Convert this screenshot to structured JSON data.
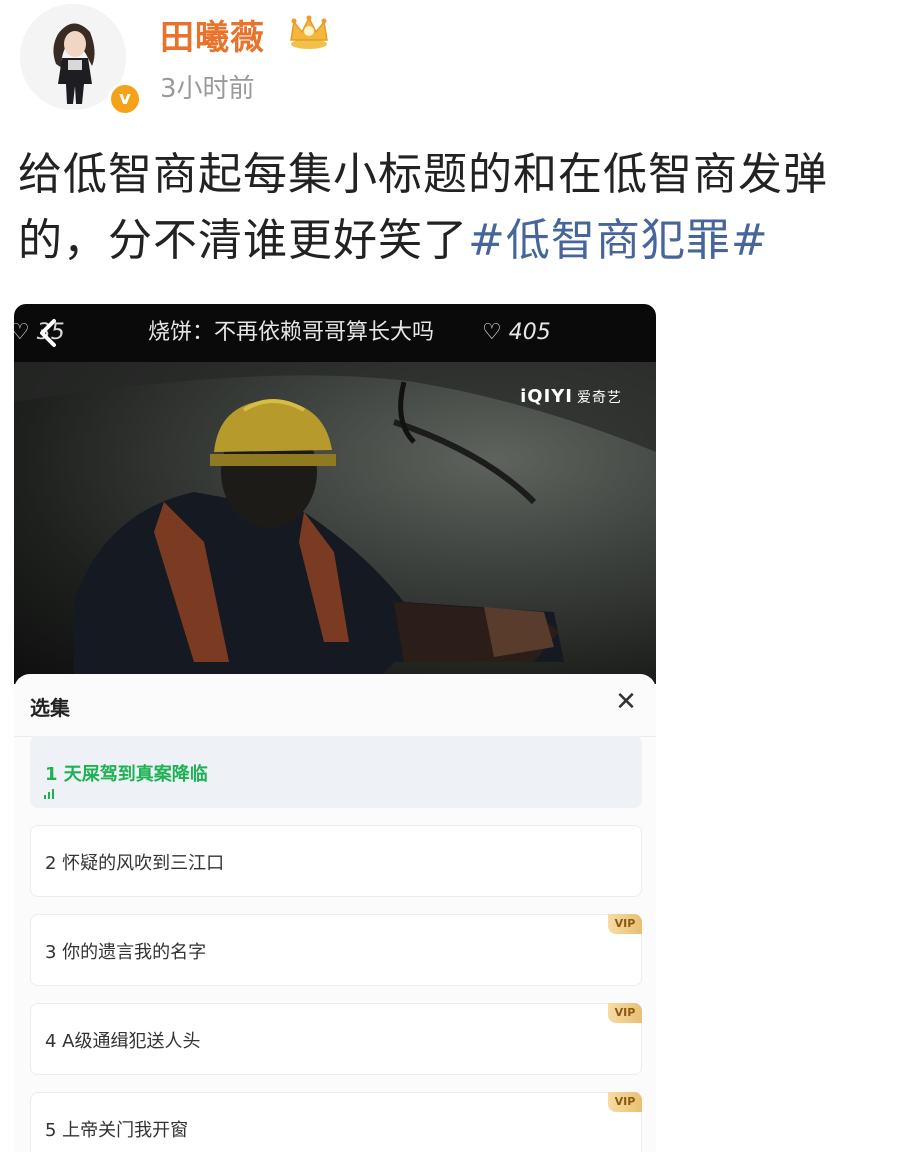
{
  "post": {
    "author": "田曦薇",
    "time": "3小时前",
    "text": "给低智商起每集小标题的和在低智商发弹的，分不清谁更好笑了",
    "hashtag": "#低智商犯罪#"
  },
  "embedded": {
    "danmu_left": "35",
    "danmu_text": "烧饼：不再依赖哥哥算长大吗",
    "danmu_count": "♡ 405",
    "watermark": "iQIYI",
    "watermark_cn": "爱奇艺",
    "panel_title": "选集",
    "close_symbol": "✕",
    "vip_label": "VIP",
    "episodes": [
      {
        "label": "1 天屎驾到真案降临",
        "active": true,
        "vip": false
      },
      {
        "label": "2 怀疑的风吹到三江口",
        "active": false,
        "vip": false
      },
      {
        "label": "3 你的遗言我的名字",
        "active": false,
        "vip": true
      },
      {
        "label": "4 A级通缉犯送人头",
        "active": false,
        "vip": true
      },
      {
        "label": "5 上帝关门我开窗",
        "active": false,
        "vip": true
      }
    ]
  },
  "colors": {
    "author": "#e8732c",
    "hashtag": "#46659a",
    "active_episode": "#1fb254",
    "verified": "#f6a11a"
  },
  "icons": [
    "avatar",
    "verified-badge-icon",
    "crown-badge-icon",
    "back-arrow-icon",
    "heart-icon",
    "close-icon",
    "playing-bars-icon"
  ]
}
